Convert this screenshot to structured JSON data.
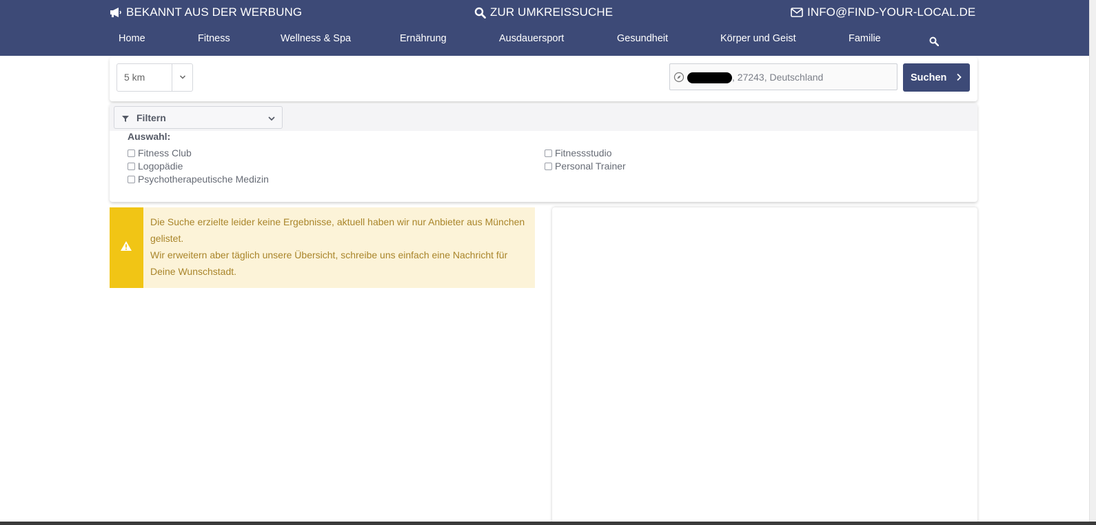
{
  "header": {
    "left_link": "BEKANNT AUS DER WERBUNG",
    "center_link": "ZUR UMKREISSUCHE",
    "right_link": "INFO@FIND-YOUR-LOCAL.DE",
    "nav": [
      "Home",
      "Fitness",
      "Wellness & Spa",
      "Ernährung",
      "Ausdauersport",
      "Gesundheit",
      "Körper und Geist",
      "Familie"
    ],
    "icons": [
      "megaphone-icon",
      "search-icon",
      "envelope-icon"
    ]
  },
  "search": {
    "radius_value": "5 km",
    "location_text": ", 27243, Deutschland",
    "button_label": "Suchen"
  },
  "filter": {
    "toggle_label": "Filtern",
    "selection_label": "Auswahl:",
    "options_left": [
      "Fitness Club",
      "Logopädie",
      "Psychotherapeutische Medizin"
    ],
    "options_right": [
      "Fitnessstudio",
      "Personal Trainer"
    ]
  },
  "alert": {
    "line1": "Die Suche erzielte leider keine Ergebnisse, aktuell haben wir nur Anbieter aus München gelistet.",
    "line2": "Wir erweitern aber täglich unsere Übersicht, schreibe uns einfach eine Nachricht für Deine Wunschstadt."
  },
  "colors": {
    "brand": "#3d4a77",
    "warning_accent": "#f1c515",
    "warning_bg": "#fcf3d8",
    "warning_text": "#a9852a"
  }
}
